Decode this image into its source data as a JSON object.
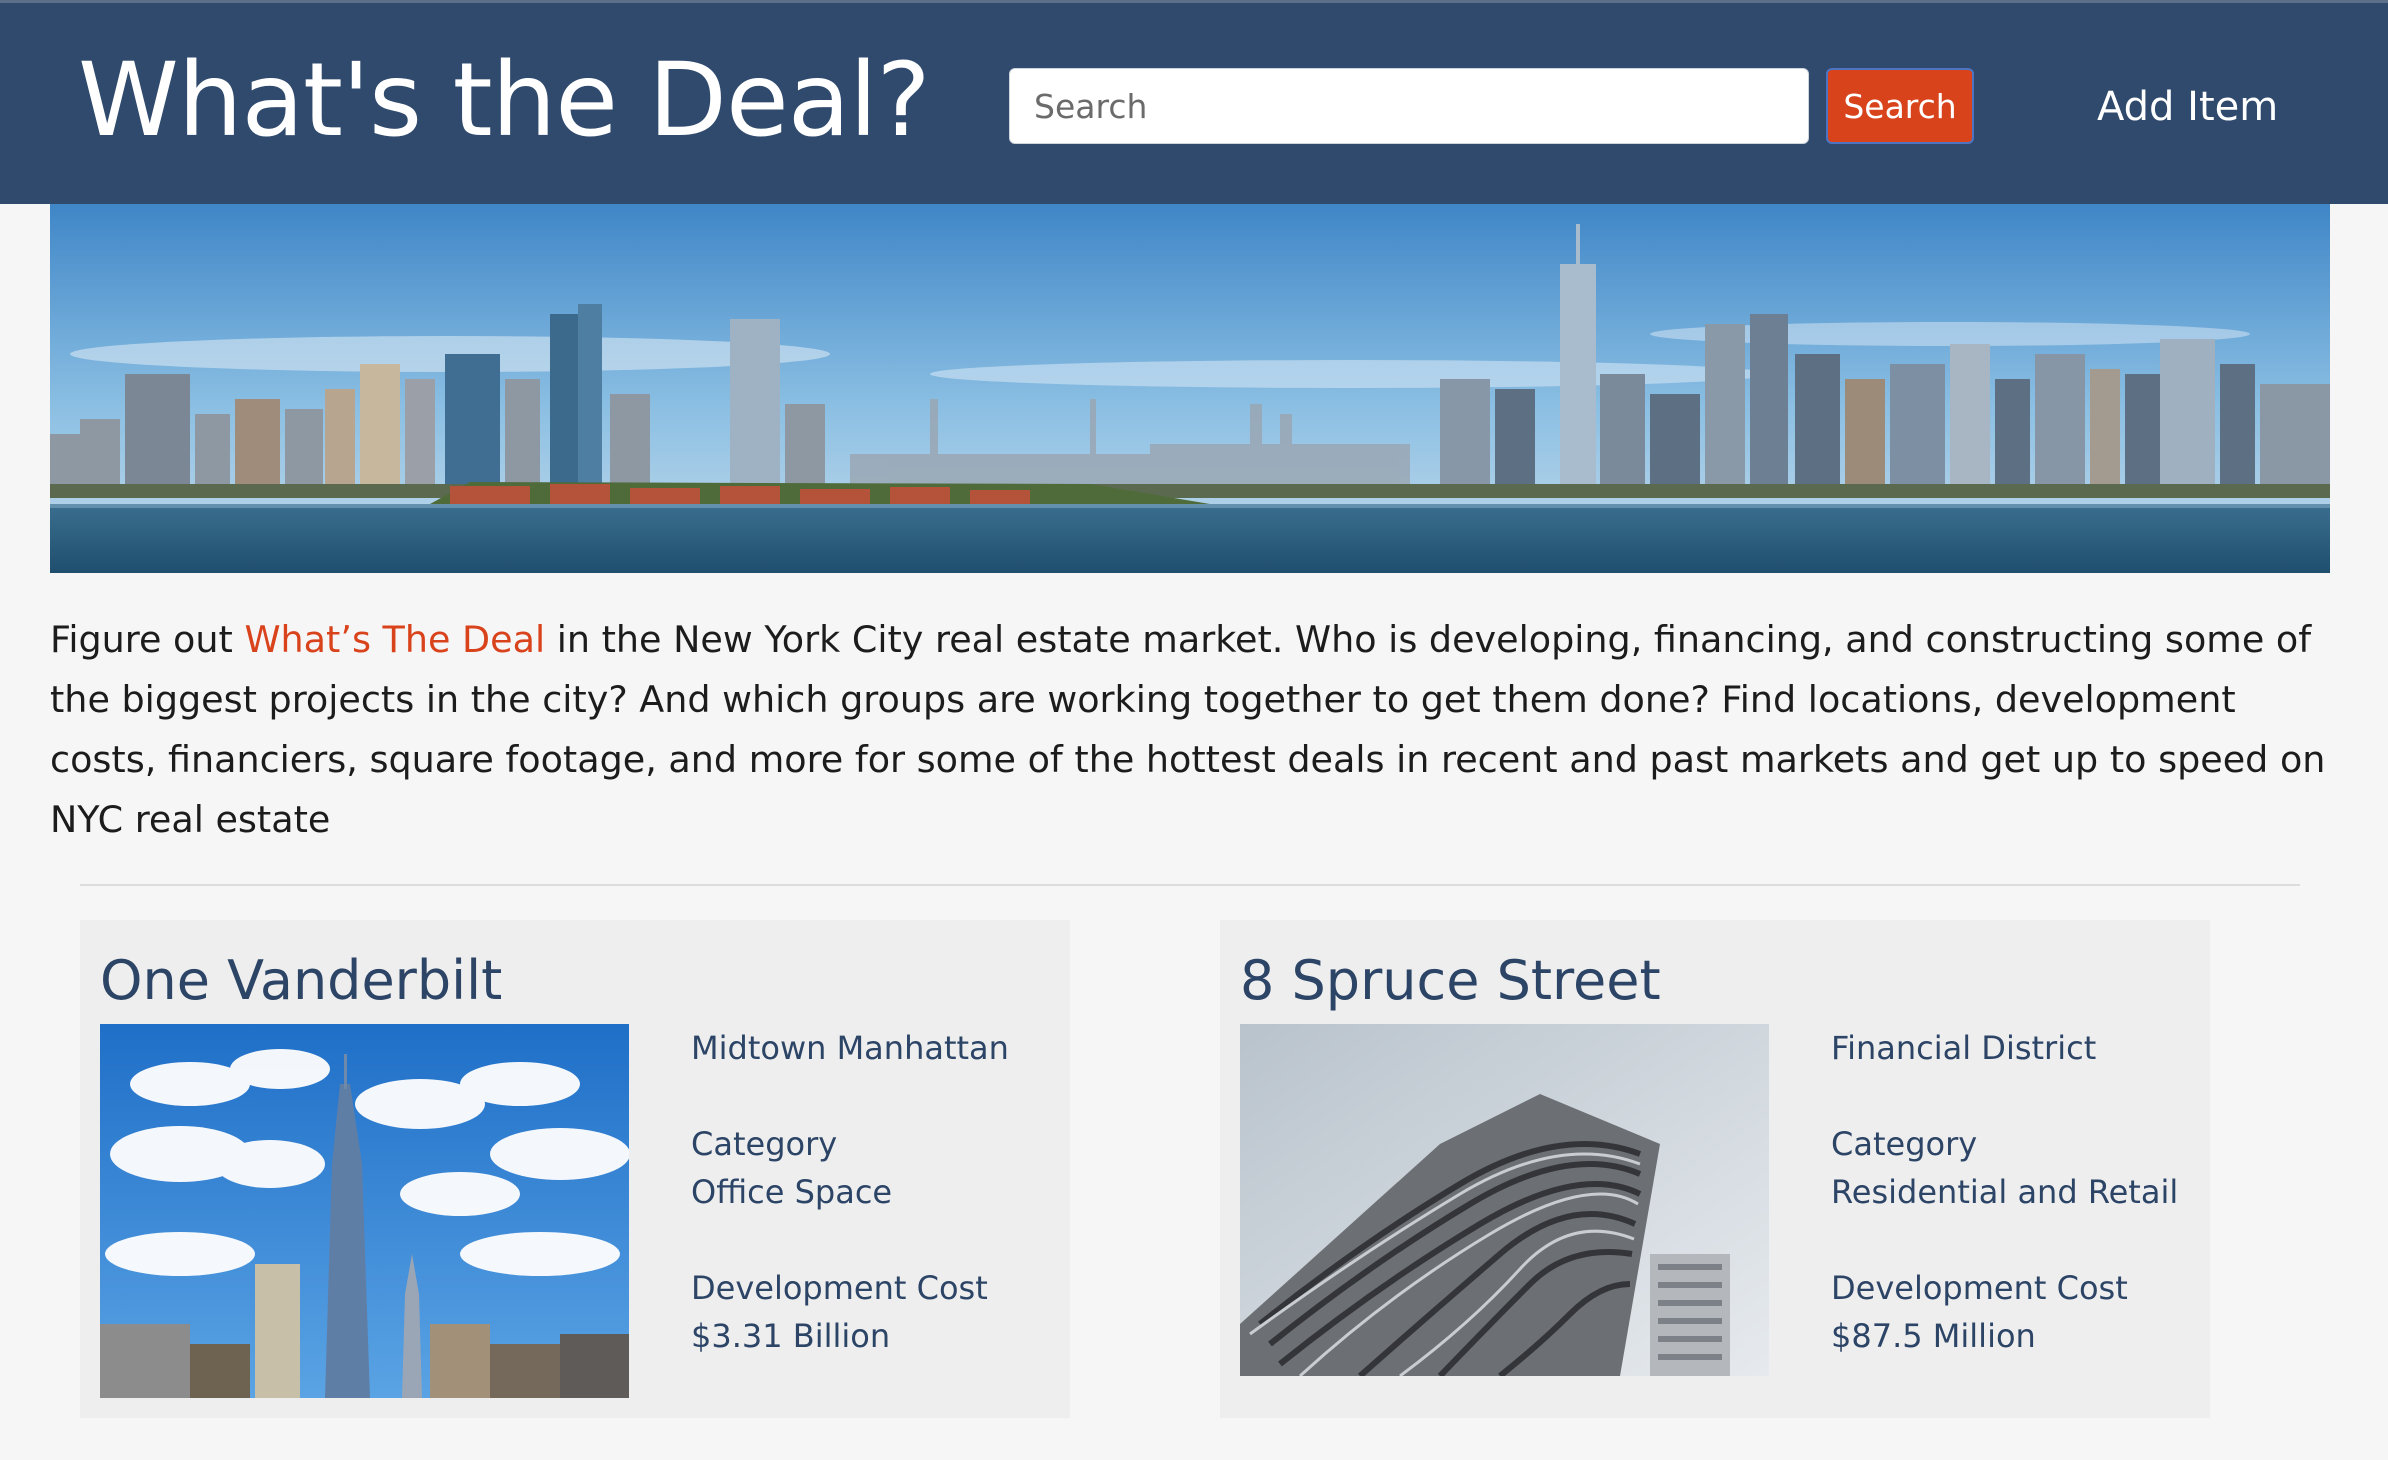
{
  "header": {
    "brand": "What's the Deal?",
    "search_placeholder": "Search",
    "search_button": "Search",
    "add_item": "Add Item",
    "colors": {
      "navbar": "#2f4a6d",
      "accent": "#d9431c"
    }
  },
  "hero": {
    "image_name": "nyc-skyline-panorama"
  },
  "intro": {
    "before": "Figure out ",
    "highlight": "What’s The Deal",
    "after": " in the New York City real estate market. Who is developing, financing, and constructing some of the biggest projects in the city? And which groups are working together to get them done? Find locations, development costs, financiers, square footage, and more for some of the hottest deals in recent and past markets and get up to speed on NYC real estate"
  },
  "deals": [
    {
      "title": "One Vanderbilt",
      "location": "Midtown Manhattan",
      "category_label": "Category",
      "category": "Office Space",
      "cost_label": "Development Cost",
      "cost": "$3.31 Billion",
      "image_name": "one-vanderbilt-photo"
    },
    {
      "title": "8 Spruce Street",
      "location": "Financial District",
      "category_label": "Category",
      "category": "Residential and Retail",
      "cost_label": "Development Cost",
      "cost": "$87.5 Million",
      "image_name": "8-spruce-street-photo"
    }
  ]
}
